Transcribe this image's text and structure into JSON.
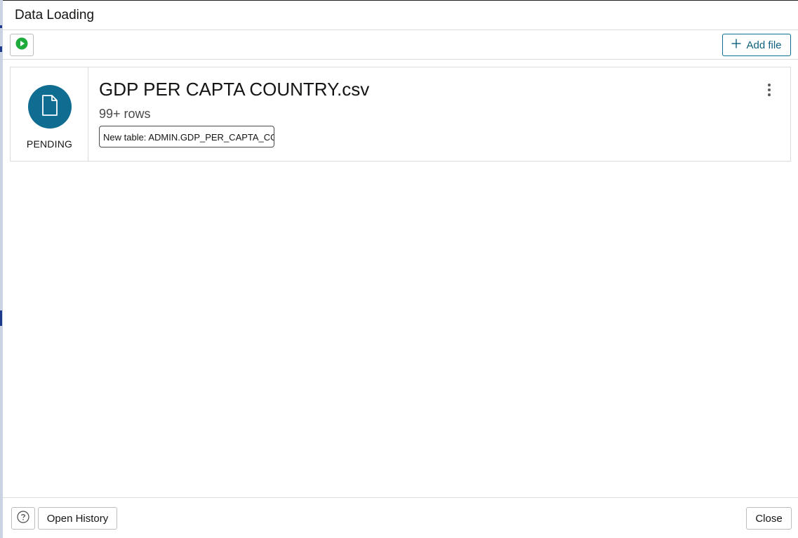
{
  "dialog": {
    "title": "Data Loading"
  },
  "toolbar": {
    "run_icon": "play-circle-icon",
    "run_color": "#1faa3c",
    "add_file_icon": "plus-icon",
    "add_file_label": "Add file",
    "accent_color": "#0f6f8f"
  },
  "files": [
    {
      "status_icon": "document-icon",
      "status_color": "#0f6d91",
      "status": "PENDING",
      "name": "GDP PER CAPTA COUNTRY.csv",
      "rows": "99+ rows",
      "target_table": "New table: ADMIN.GDP_PER_CAPTA_CO...",
      "menu_icon": "kebab-menu-icon"
    }
  ],
  "footer": {
    "help_icon": "help-circle-icon",
    "history_label": "Open History",
    "close_label": "Close"
  }
}
